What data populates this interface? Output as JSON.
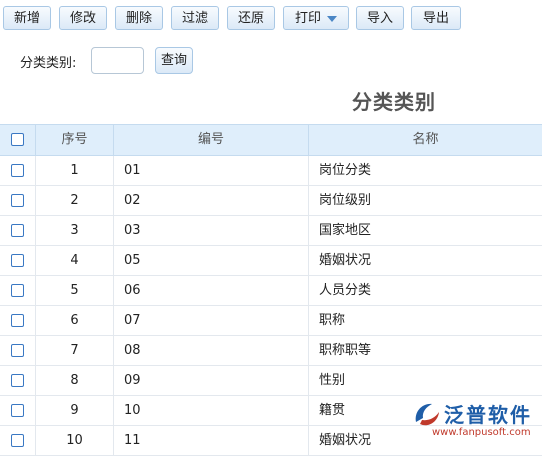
{
  "toolbar": {
    "buttons": [
      "新增",
      "修改",
      "删除",
      "过滤",
      "还原",
      "打印",
      "导入",
      "导出"
    ]
  },
  "filter": {
    "label": "分类类别:",
    "input_value": "",
    "query_label": "查询"
  },
  "page_title": "分类类别",
  "table": {
    "columns": [
      "序号",
      "编号",
      "名称"
    ],
    "rows": [
      {
        "seq": "1",
        "code": "01",
        "name": "岗位分类"
      },
      {
        "seq": "2",
        "code": "02",
        "name": "岗位级别"
      },
      {
        "seq": "3",
        "code": "03",
        "name": "国家地区"
      },
      {
        "seq": "4",
        "code": "05",
        "name": "婚姻状况"
      },
      {
        "seq": "5",
        "code": "06",
        "name": "人员分类"
      },
      {
        "seq": "6",
        "code": "07",
        "name": "职称"
      },
      {
        "seq": "7",
        "code": "08",
        "name": "职称职等"
      },
      {
        "seq": "8",
        "code": "09",
        "name": "性别"
      },
      {
        "seq": "9",
        "code": "10",
        "name": "籍贯"
      },
      {
        "seq": "10",
        "code": "11",
        "name": "婚姻状况"
      }
    ]
  },
  "watermark": {
    "brand": "泛普软件",
    "url": "www.fanpusoft.com"
  },
  "colors": {
    "header_bg": "#dfeefb",
    "checkbox_border": "#3a78c3",
    "brand_blue": "#1f5ea8",
    "brand_red": "#c0392b"
  }
}
